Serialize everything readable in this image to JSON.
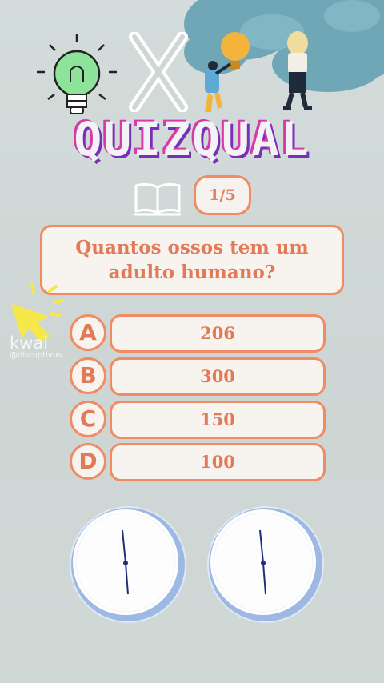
{
  "header": {
    "title": "QUIZQUAL",
    "progress": "1/5"
  },
  "question": {
    "text": "Quantos ossos tem um adulto humano?"
  },
  "options": [
    {
      "letter": "A",
      "answer": "206"
    },
    {
      "letter": "B",
      "answer": "300"
    },
    {
      "letter": "C",
      "answer": "150"
    },
    {
      "letter": "D",
      "answer": "100"
    }
  ],
  "watermark": {
    "brand": "kwai",
    "handle": "@disruptivus"
  },
  "icons": [
    "lightbulb-icon",
    "x-icon",
    "person-with-lightbulb-illustration",
    "woman-illustration",
    "open-book-icon",
    "click-cursor-icon",
    "clock-icon"
  ],
  "colors": {
    "accent": "#f08b63",
    "text": "#e27957",
    "card": "#f7f3ef",
    "title_pink": "#d63aa8",
    "title_purple": "#7a2fb8",
    "smoke": "#5f9eb0"
  }
}
